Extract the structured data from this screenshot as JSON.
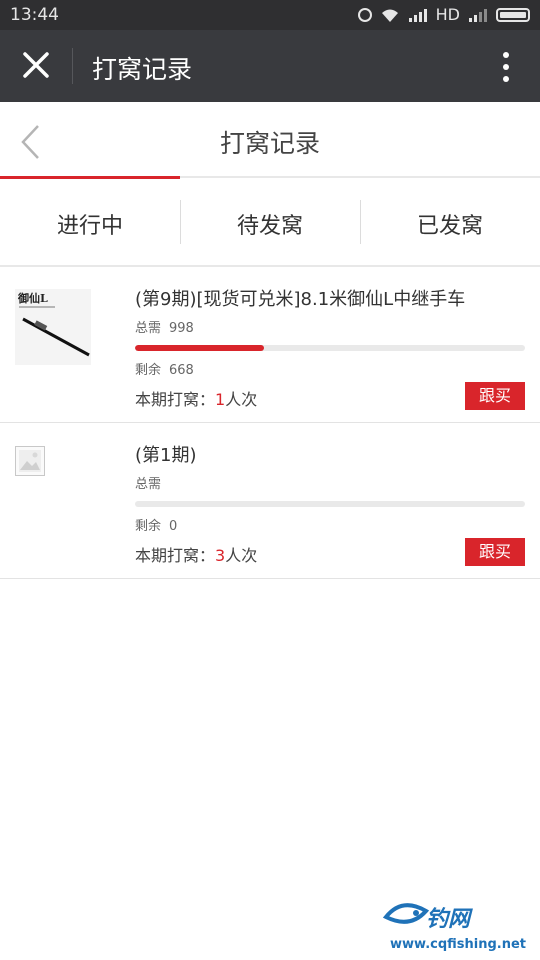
{
  "status_bar": {
    "time": "13:44",
    "network_label": "HD",
    "icons": [
      "alarm-icon",
      "wifi-icon",
      "signal-icon",
      "signal-icon",
      "battery-icon"
    ]
  },
  "app_bar": {
    "title": "打窝记录",
    "close_icon": "close-icon",
    "more_icon": "more-vertical-icon"
  },
  "page": {
    "title": "打窝记录",
    "back_icon": "chevron-left-icon",
    "accent_color": "#d9252b"
  },
  "tabs": [
    {
      "label": "进行中",
      "active": true
    },
    {
      "label": "待发窝",
      "active": false
    },
    {
      "label": "已发窝",
      "active": false
    }
  ],
  "items": [
    {
      "title": "(第9期)[现货可兑米]8.1米御仙L中继手车",
      "total_label": "总需",
      "total_value": "998",
      "progress": 0.33,
      "remain_label": "剩余",
      "remain_value": "668",
      "count_prefix": "本期打窝：",
      "count_value": "1",
      "count_suffix": "人次",
      "buy_label": "跟买",
      "thumb_text": "御仙L"
    },
    {
      "title": "(第1期)",
      "total_label": "总需",
      "total_value": "",
      "progress": 0,
      "remain_label": "剩余",
      "remain_value": "0",
      "count_prefix": "本期打窝：",
      "count_value": "3",
      "count_suffix": "人次",
      "buy_label": "跟买"
    }
  ],
  "watermark": {
    "brand": "钓网",
    "url": "www.cqfishing.net"
  }
}
